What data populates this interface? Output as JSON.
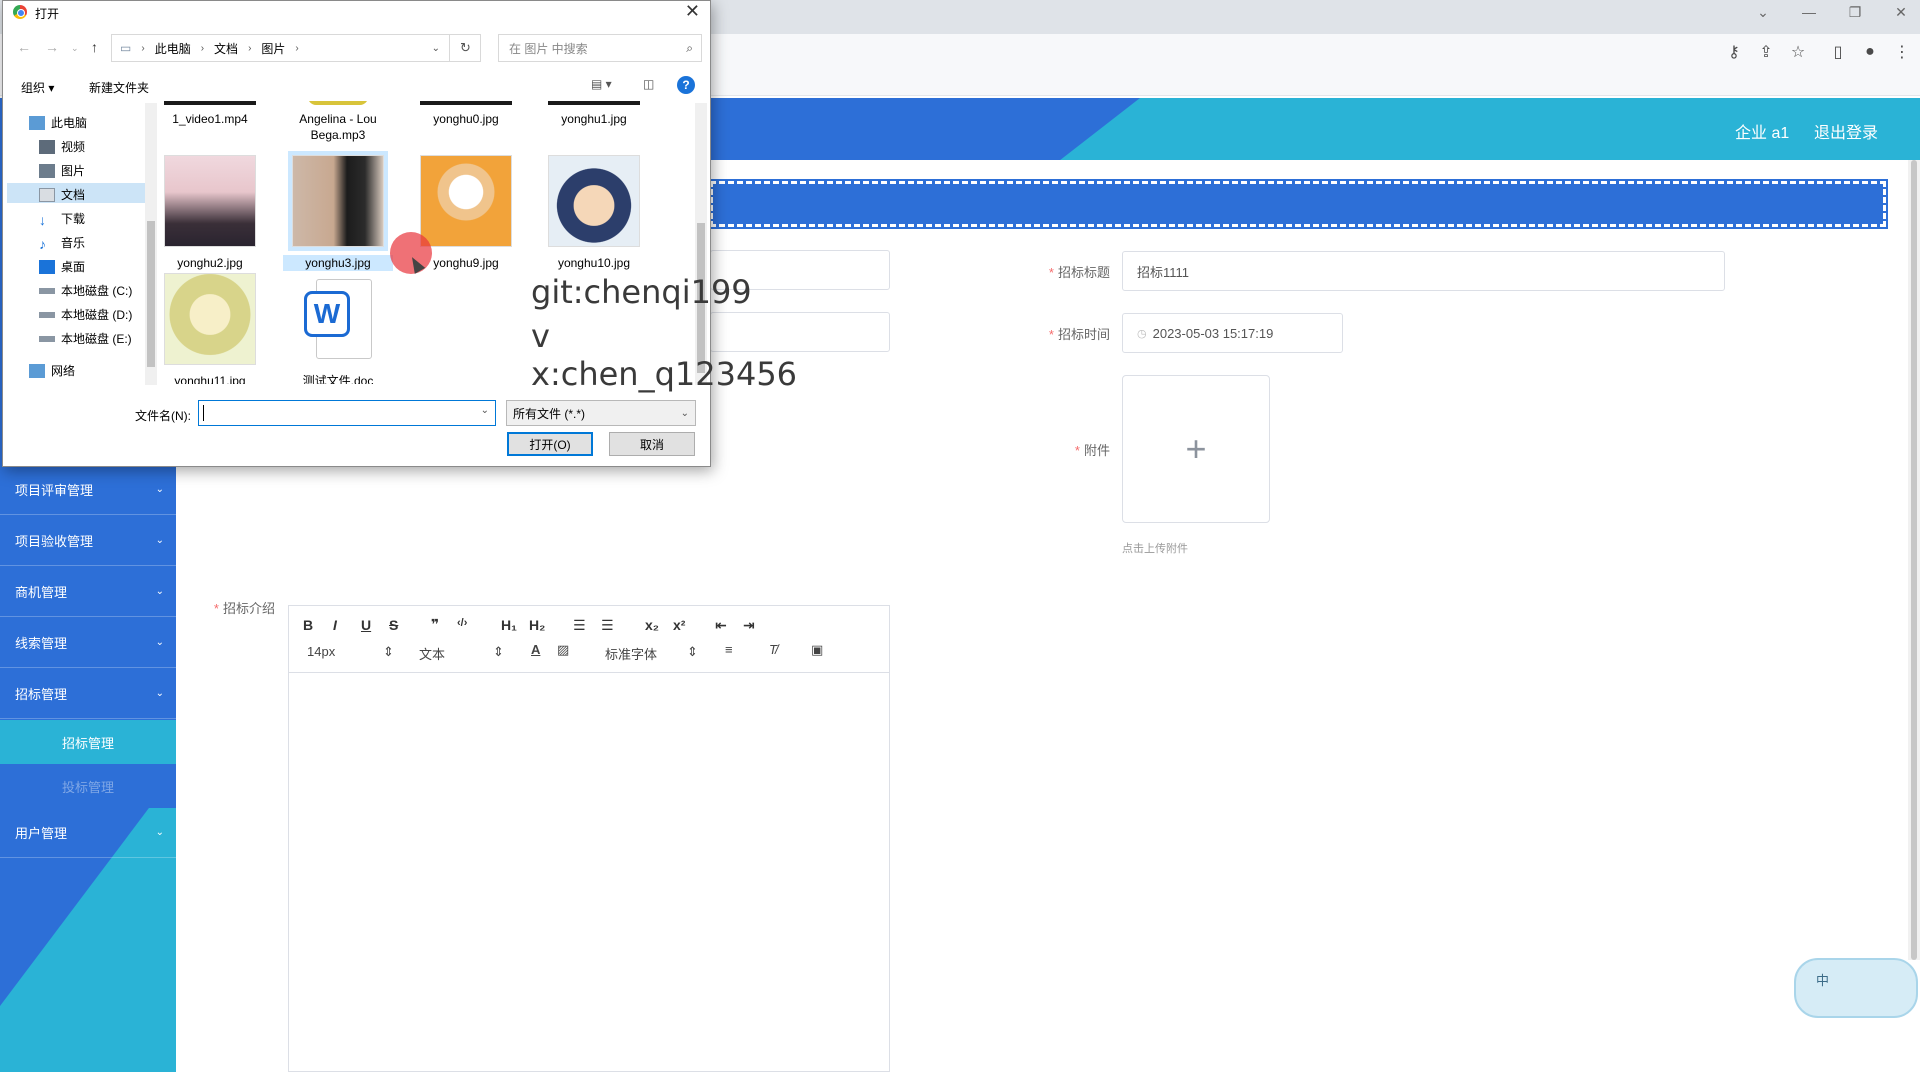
{
  "browser": {
    "window_controls": [
      "⌄",
      "—",
      "❐",
      "✕"
    ]
  },
  "app": {
    "user_name": "企业 a1",
    "logout": "退出登录"
  },
  "sidebar": {
    "items": [
      {
        "label": "项目评审管理"
      },
      {
        "label": "项目验收管理"
      },
      {
        "label": "商机管理"
      },
      {
        "label": "线索管理"
      },
      {
        "label": "招标管理"
      }
    ],
    "sub_items": [
      {
        "label": "招标管理",
        "active": true
      },
      {
        "label": "投标管理",
        "active": false
      }
    ],
    "last_item": {
      "label": "用户管理"
    }
  },
  "form": {
    "title_label": "招标标题",
    "title_value": "招标1111",
    "time_label": "招标时间",
    "time_value": "2023-05-03 15:17:19",
    "attachment_label": "附件",
    "upload_plus": "+",
    "upload_hint": "点击上传附件",
    "intro_label": "招标介绍"
  },
  "editor": {
    "font_size": "14px",
    "paragraph": "文本",
    "font_family": "标准字体",
    "buttons": [
      "B",
      "I",
      "U",
      "S",
      "❞",
      "‹/›",
      "H₁",
      "H₂",
      "☰",
      "☰",
      "x₂",
      "x²",
      "⇤",
      "⇥"
    ]
  },
  "dialog": {
    "title": "打开",
    "path": [
      "此电脑",
      "文档",
      "图片"
    ],
    "search_placeholder": "在 图片 中搜索",
    "organize": "组织 ▾",
    "new_folder": "新建文件夹",
    "tree": [
      {
        "label": "此电脑"
      },
      {
        "label": "视频"
      },
      {
        "label": "图片"
      },
      {
        "label": "文档"
      },
      {
        "label": "下载"
      },
      {
        "label": "音乐"
      },
      {
        "label": "桌面"
      },
      {
        "label": "本地磁盘 (C:)"
      },
      {
        "label": "本地磁盘 (D:)"
      },
      {
        "label": "本地磁盘 (E:)"
      },
      {
        "label": "网络"
      }
    ],
    "files": [
      {
        "name": "1_video1.mp4"
      },
      {
        "name": "Angelina - Lou Bega.mp3"
      },
      {
        "name": "yonghu0.jpg"
      },
      {
        "name": "yonghu1.jpg"
      },
      {
        "name": "yonghu2.jpg"
      },
      {
        "name": "yonghu3.jpg"
      },
      {
        "name": "yonghu9.jpg"
      },
      {
        "name": "yonghu10.jpg"
      },
      {
        "name": "yonghu11.jpg"
      },
      {
        "name": "测试文件.doc"
      }
    ],
    "filename_label": "文件名(N):",
    "filename_value": "",
    "filetype": "所有文件 (*.*)",
    "open_button": "打开(O)",
    "cancel_button": "取消"
  },
  "watermark": {
    "line1": "git:chenqi199",
    "line2": "v x:chen_q123456"
  },
  "ime": {
    "label": "中"
  },
  "colors": {
    "primary_blue": "#2d6fd7",
    "accent_cyan": "#2ab3d6",
    "required_red": "#f56c6c",
    "selection_blue": "#cce8ff"
  }
}
